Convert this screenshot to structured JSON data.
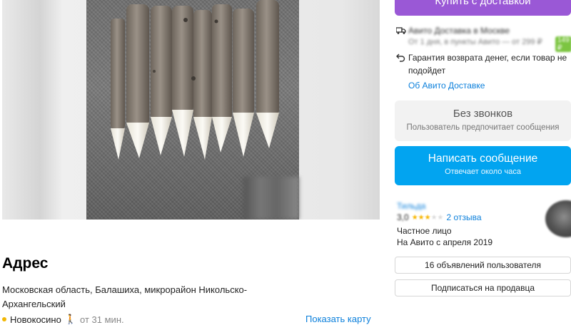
{
  "gallery": {
    "photo_description_icon": "photo-of-wooden-pegs"
  },
  "address": {
    "title": "Адрес",
    "text": "Московская область, Балашиха, микрорайон Никольско-Архангельский",
    "metro_station": "Новокосино",
    "metro_time": "от 31 мин.",
    "map_link": "Показать карту"
  },
  "buy_button": {
    "label": "Купить с доставкой"
  },
  "delivery": {
    "title": "Авито Доставка в Москве",
    "subtitle": "От 1 дня, в пункты Авито — от 299 ₽",
    "badge": "149 ₽"
  },
  "guarantee": {
    "text": "Гарантия возврата денег, если товар не подойдет"
  },
  "delivery_link": {
    "label": "Об Авито Доставке"
  },
  "no_calls": {
    "title": "Без звонков",
    "subtitle": "Пользователь предпочитает сообщения"
  },
  "message_button": {
    "title": "Написать сообщение",
    "subtitle": "Отвечает около часа"
  },
  "seller": {
    "name": "Тильда",
    "rating": "3,0",
    "reviews": "2 отзыва",
    "type": "Частное лицо",
    "since": "На Авито с апреля 2019"
  },
  "user_ads_button": {
    "label": "16 объявлений пользователя"
  },
  "subscribe_button": {
    "label": "Подписаться на продавца"
  },
  "colors": {
    "buy_button": "#9a58d6",
    "message_button": "#02a4f0",
    "link": "#0a7fdb",
    "star": "#f7b500",
    "metro_dot": "#f2b705"
  }
}
